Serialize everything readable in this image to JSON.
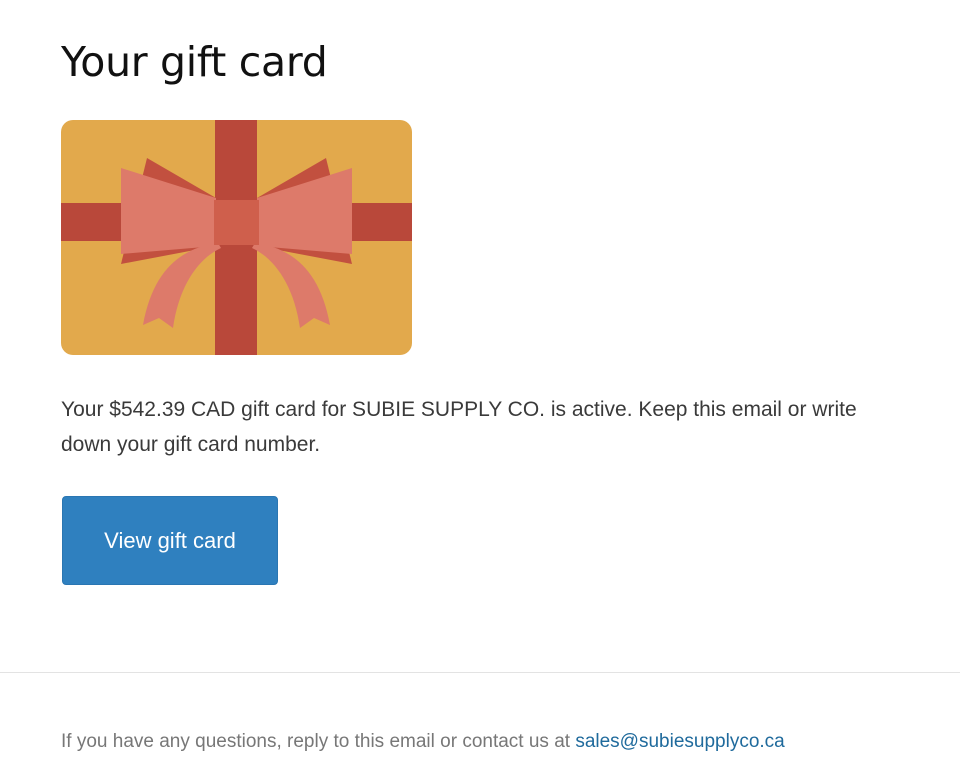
{
  "header": {
    "title": "Your gift card"
  },
  "gift_card_image": {
    "icon": "gift-card-ribbon-bow-icon",
    "colors": {
      "card": "#e2a94c",
      "ribbon": "#b9483a",
      "bow": "#dd7a6a"
    }
  },
  "message": {
    "text": "Your $542.39 CAD gift card for SUBIE SUPPLY CO. is active. Keep this email or write down your gift card number."
  },
  "actions": {
    "view_label": "View gift card",
    "button_color": "#2f80bf"
  },
  "footer": {
    "text": "If you have any questions, reply to this email or contact us at ",
    "email": "sales@subiesupplyco.ca",
    "link_color": "#1f6a9c"
  }
}
